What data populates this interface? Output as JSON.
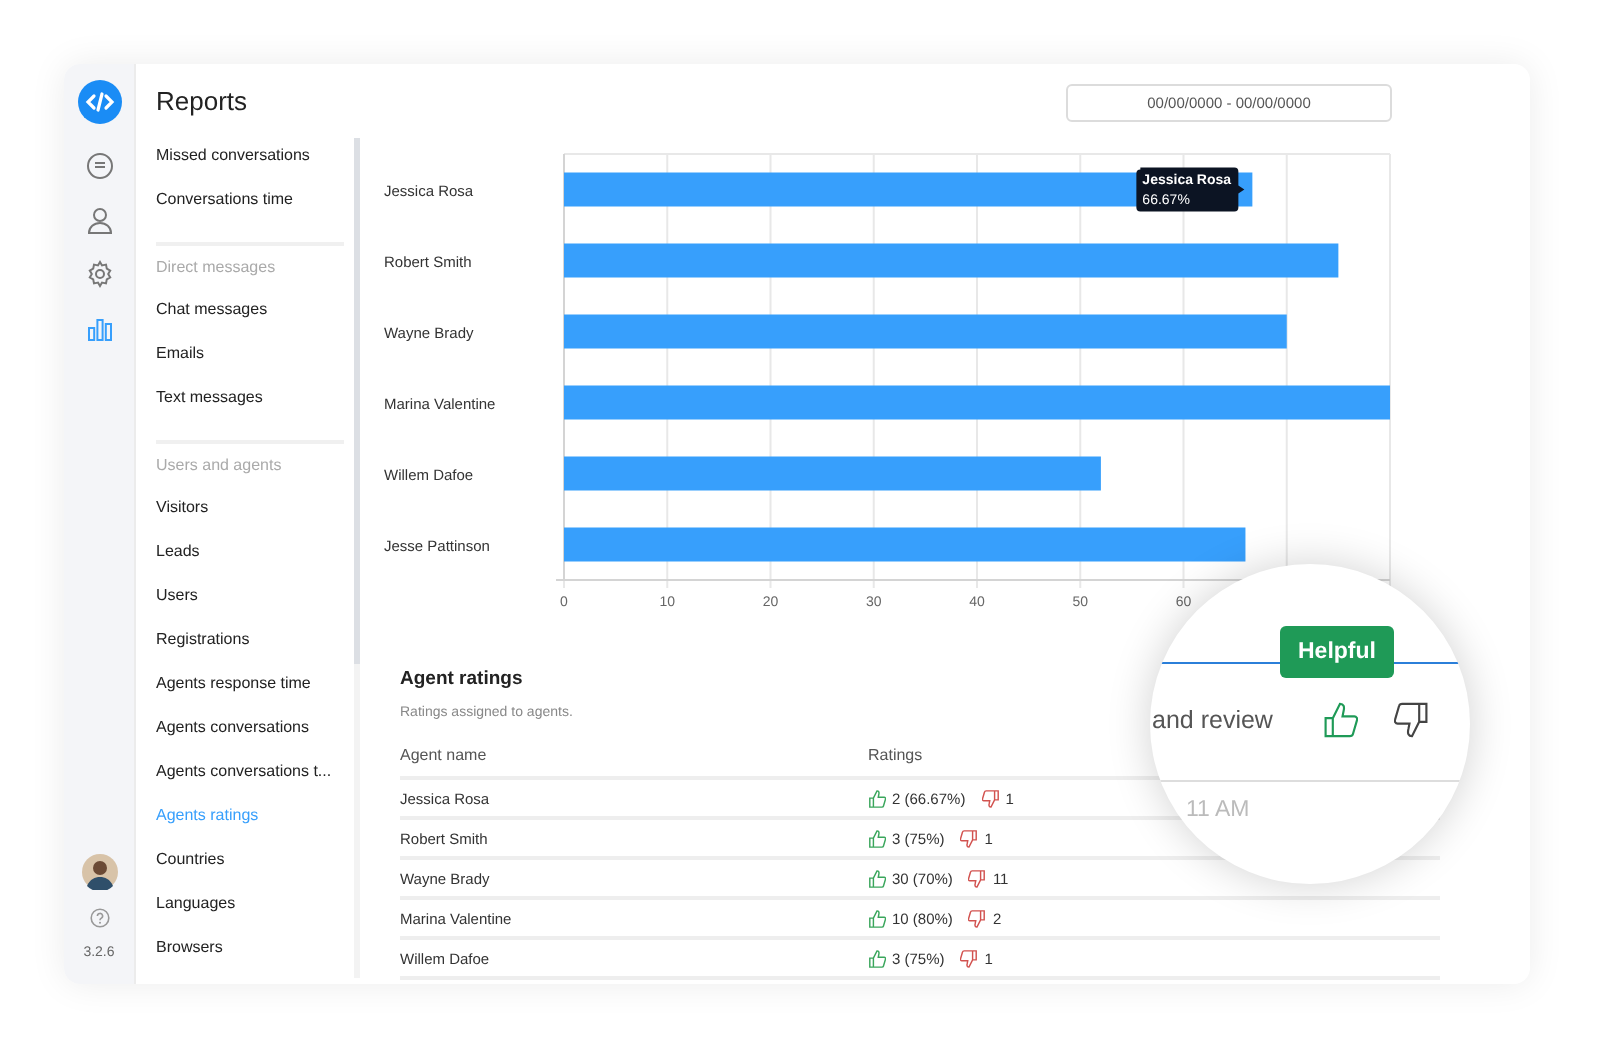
{
  "rail": {
    "items": [
      {
        "kind": "chat",
        "selected": false
      },
      {
        "kind": "user",
        "selected": false
      },
      {
        "kind": "settings",
        "selected": false
      },
      {
        "kind": "reports",
        "selected": true
      }
    ],
    "version": "3.2.6"
  },
  "nav": {
    "title": "Reports",
    "sections": [
      {
        "items": [
          {
            "label": "Missed conversations",
            "selected": false
          },
          {
            "label": "Conversations time",
            "selected": false
          }
        ]
      },
      {
        "heading": "Direct messages",
        "items": [
          {
            "label": "Chat messages",
            "selected": false
          },
          {
            "label": "Emails",
            "selected": false
          },
          {
            "label": "Text messages",
            "selected": false
          }
        ]
      },
      {
        "heading": "Users and agents",
        "items": [
          {
            "label": "Visitors",
            "selected": false
          },
          {
            "label": "Leads",
            "selected": false
          },
          {
            "label": "Users",
            "selected": false
          },
          {
            "label": "Registrations",
            "selected": false
          },
          {
            "label": "Agents response time",
            "selected": false
          },
          {
            "label": "Agents conversations",
            "selected": false
          },
          {
            "label": "Agents conversations t...",
            "selected": false
          },
          {
            "label": "Agents ratings",
            "selected": true
          },
          {
            "label": "Countries",
            "selected": false
          },
          {
            "label": "Languages",
            "selected": false
          },
          {
            "label": "Browsers",
            "selected": false
          }
        ]
      }
    ]
  },
  "date_range": {
    "value": "00/00/0000 - 00/00/0000"
  },
  "chart": {
    "chart_data": {
      "type": "bar",
      "orientation": "horizontal",
      "categories": [
        "Jessica Rosa",
        "Robert Smith",
        "Wayne Brady",
        "Marina Valentine",
        "Willem Dafoe",
        "Jesse Pattinson"
      ],
      "series": [
        {
          "color": "#379ffc",
          "values": [
            66.67,
            75,
            70,
            80,
            52,
            66
          ]
        }
      ],
      "xlim": [
        0,
        80
      ],
      "xticks": [
        0,
        10,
        20,
        30,
        40,
        50,
        60
      ],
      "grid": true
    },
    "tooltip": {
      "title": "Jessica Rosa",
      "text": "66.67%"
    }
  },
  "ratings": {
    "title": "Agent ratings",
    "subtitle": "Ratings assigned to agents.",
    "columns": [
      "Agent name",
      "Ratings"
    ],
    "rows": [
      {
        "name": "Jessica Rosa",
        "up": "2 (66.67%)",
        "down": "1"
      },
      {
        "name": "Robert Smith",
        "up": "3 (75%)",
        "down": "1"
      },
      {
        "name": "Wayne Brady",
        "up": "30 (70%)",
        "down": "11"
      },
      {
        "name": "Marina Valentine",
        "up": "10 (80%)",
        "down": "2"
      },
      {
        "name": "Willem Dafoe",
        "up": "3 (75%)",
        "down": "1"
      }
    ]
  },
  "magnifier": {
    "badge": "Helpful",
    "text": "and review",
    "time": "11 AM"
  }
}
